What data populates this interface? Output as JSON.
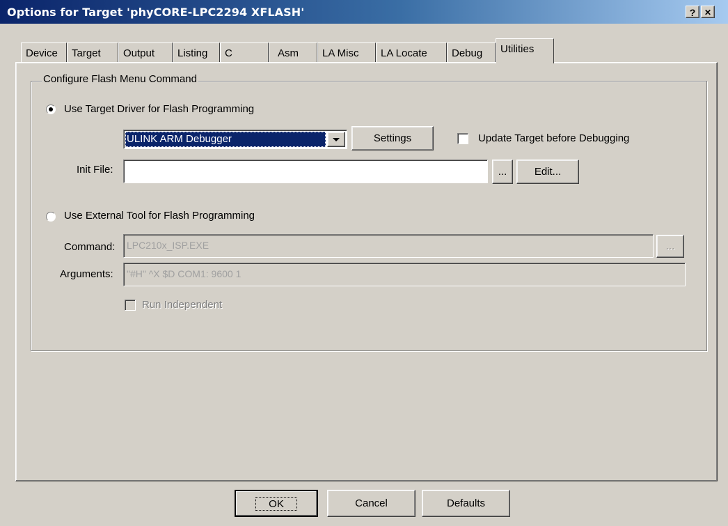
{
  "window": {
    "title": "Options for Target 'phyCORE-LPC2294 XFLASH'",
    "help_label": "?",
    "close_label": "✕"
  },
  "tabs": [
    "Device",
    "Target",
    "Output",
    "Listing",
    "C",
    "Asm",
    "LA Misc",
    "LA Locate",
    "Debug",
    "Utilities"
  ],
  "active_tab": "Utilities",
  "flash_group": {
    "legend": "Configure Flash Menu Command",
    "use_target_driver_label": "Use Target Driver for Flash Programming",
    "use_target_driver_selected": true,
    "driver_value": "ULINK ARM Debugger",
    "settings_label": "Settings",
    "update_target_label": "Update Target before Debugging",
    "update_target_checked": false,
    "init_file_label": "Init File:",
    "init_file_value": "",
    "browse_label": "...",
    "edit_label": "Edit...",
    "use_external_label": "Use External Tool for Flash Programming",
    "use_external_selected": false,
    "command_label": "Command:",
    "command_value": "LPC210x_ISP.EXE",
    "arguments_label": "Arguments:",
    "arguments_value": "\"#H\" ^X $D COM1: 9600 1",
    "run_independent_label": "Run Independent",
    "run_independent_checked": false
  },
  "footer": {
    "ok_label": "OK",
    "cancel_label": "Cancel",
    "defaults_label": "Defaults"
  },
  "colors": {
    "dialog_bg": "#d4d0c8",
    "title_start": "#0a246a",
    "title_end": "#a6caf0",
    "selection": "#0a246a"
  }
}
